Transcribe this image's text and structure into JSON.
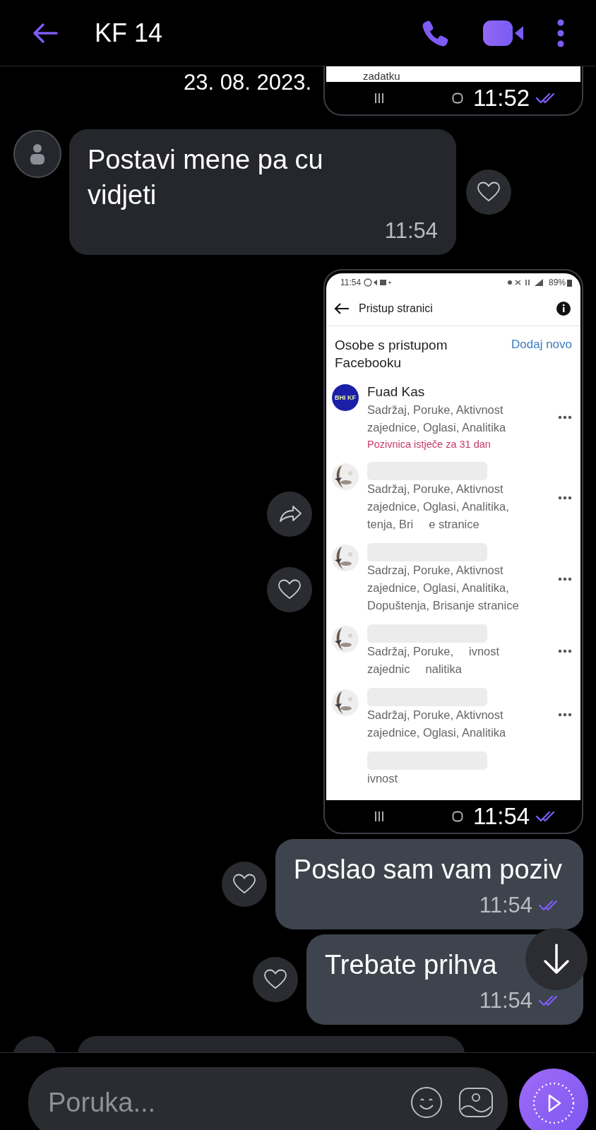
{
  "header": {
    "title": "KF 14"
  },
  "date_label": "23. 08. 2023.",
  "messages": [
    {
      "kind": "image_top",
      "cropped_text": "zadatku",
      "time": "11:52",
      "read": true
    },
    {
      "kind": "text_in",
      "text": "Postavi mene pa cu vidjeti",
      "time": "11:54"
    },
    {
      "kind": "screenshot",
      "time": "11:54",
      "read": true,
      "screenshot": {
        "status_time": "11:54",
        "battery": "89%",
        "title": "Pristup stranici",
        "section_title": "Osobe s pristupom Facebooku",
        "add_link": "Dodaj novo",
        "people": [
          {
            "kind": "logo",
            "avatar_text": "BHI KF",
            "redacted": false,
            "name": "Fuad Kas",
            "lines": [
              [
                "Sadržaj, Poruke, Aktivnost"
              ],
              [
                "zajednice, Oglasi, Analitika"
              ]
            ],
            "note": "Pozivnica istječe za 31 dan",
            "menu": true
          },
          {
            "redacted": true,
            "lines": [
              [
                "Sadržaj, Poruke, Aktivnost"
              ],
              [
                "zajednice, Oglasi, Analitika,"
              ],
              [
                "tenja, Bri",
                "e stranice"
              ]
            ],
            "menu": true
          },
          {
            "redacted": true,
            "lines": [
              [
                "Sadrzaj, Poruke, Aktivnost"
              ],
              [
                "zajednice, Oglasi, Analitika,"
              ],
              [
                "Dopuštenja, Brisanje stranice"
              ]
            ],
            "menu": true
          },
          {
            "redacted": true,
            "lines": [
              [
                "Sadržaj, Poruke,",
                "ivnost"
              ],
              [
                "zajednic",
                "nalitika"
              ]
            ],
            "menu": true
          },
          {
            "redacted": true,
            "lines": [
              [
                "Sadržaj, Poruke, Aktivnost"
              ],
              [
                "zajednice, Oglasi, Analitika"
              ]
            ],
            "menu": true
          },
          {
            "kind": "blank",
            "redacted": true,
            "lines": [
              [
                "ivnost"
              ]
            ],
            "menu": false
          }
        ]
      }
    },
    {
      "kind": "text_out",
      "text": "Poslao sam vam poziv",
      "time": "11:54",
      "read": true
    },
    {
      "kind": "text_out",
      "text": "Trebate prihva",
      "time": "11:54",
      "read": true
    },
    {
      "kind": "partial_in"
    }
  ],
  "composer": {
    "placeholder": "Poruka..."
  }
}
